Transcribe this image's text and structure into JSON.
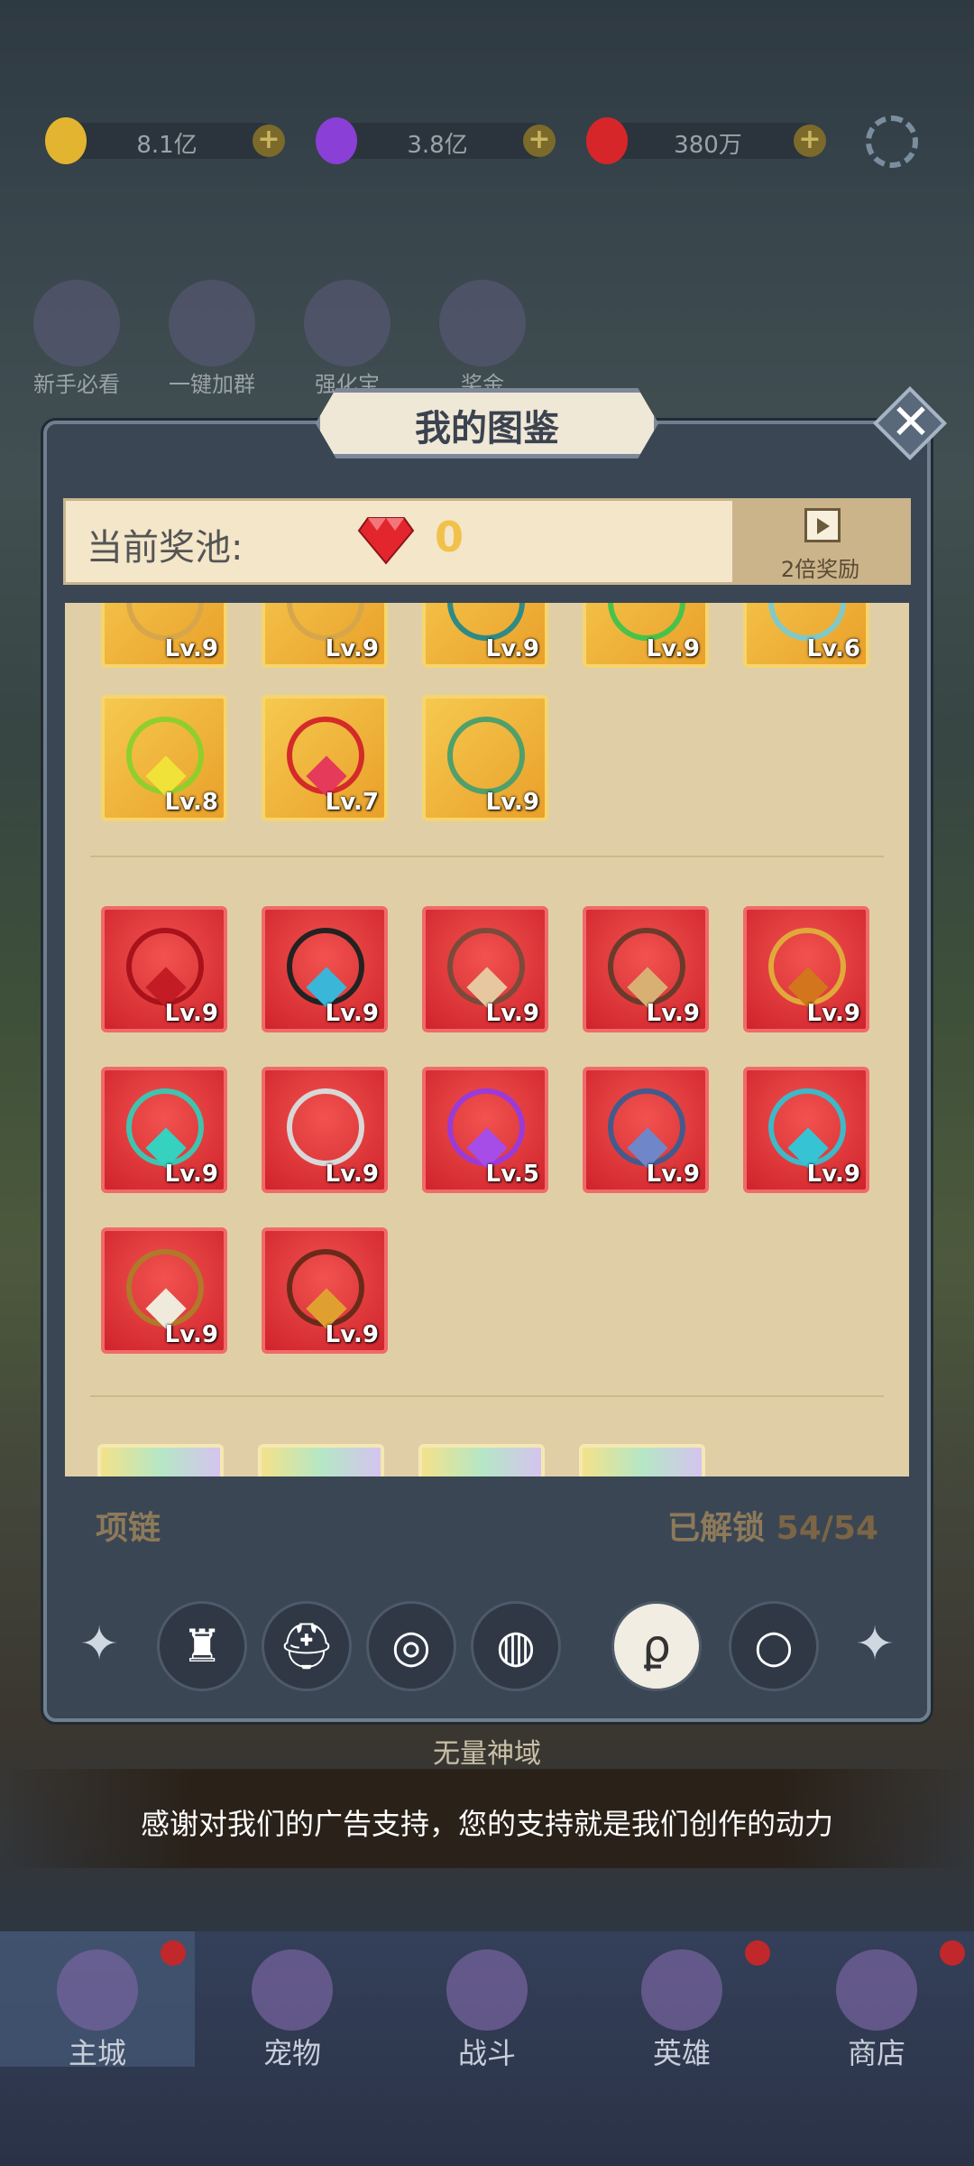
{
  "currency": [
    {
      "name": "gold",
      "value": "8.1亿",
      "color": "#e3b430"
    },
    {
      "name": "purple",
      "value": "3.8亿",
      "color": "#8a3fd6"
    },
    {
      "name": "gem",
      "value": "380万",
      "color": "#d7262a"
    }
  ],
  "shortcuts": [
    "新手必看",
    "一键加群",
    "强化宝",
    "奖金"
  ],
  "modal": {
    "title": "我的图鉴",
    "pool_label": "当前奖池:",
    "pool_value": "0",
    "reward_label": "2倍奖励"
  },
  "collection": {
    "category": "项链",
    "unlocked_label": "已解锁",
    "unlocked_count": "54/54",
    "row_top": [
      "Lv.9",
      "Lv.9",
      "Lv.9",
      "Lv.9",
      "Lv.6"
    ],
    "gold_row": [
      "Lv.8",
      "Lv.7",
      "Lv.9"
    ],
    "red_row1": [
      "Lv.9",
      "Lv.9",
      "Lv.9",
      "Lv.9",
      "Lv.9"
    ],
    "red_row2": [
      "Lv.9",
      "Lv.9",
      "Lv.5",
      "Lv.9",
      "Lv.9"
    ],
    "red_row3": [
      "Lv.9",
      "Lv.9"
    ]
  },
  "tabs": [
    "armor",
    "helmet",
    "bracer",
    "belt",
    "necklace",
    "ring"
  ],
  "notice": "感谢对我们的广告支持，您的支持就是我们创作的动力",
  "map_name": "无量神域",
  "nav": [
    "主城",
    "宠物",
    "战斗",
    "英雄",
    "商店"
  ]
}
